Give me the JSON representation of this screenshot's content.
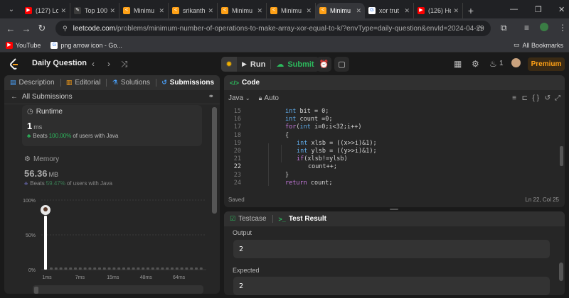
{
  "browser": {
    "tabs": [
      {
        "title": "(127) Lo",
        "fav_color": "#ff0000",
        "fav_glyph": "▶",
        "active": false
      },
      {
        "title": "Top 100",
        "fav_color": "#3b3b3b",
        "fav_glyph": "✎",
        "active": false
      },
      {
        "title": "Minimu",
        "fav_color": "#ffa116",
        "fav_glyph": "<",
        "active": false
      },
      {
        "title": "srikanth",
        "fav_color": "#ffa116",
        "fav_glyph": "<",
        "active": false
      },
      {
        "title": "Minimu",
        "fav_color": "#ffa116",
        "fav_glyph": "<",
        "active": false
      },
      {
        "title": "Minimu",
        "fav_color": "#ffa116",
        "fav_glyph": "<",
        "active": false
      },
      {
        "title": "Minimu",
        "fav_color": "#ffa116",
        "fav_glyph": "<",
        "active": true
      },
      {
        "title": "xor trut",
        "fav_color": "#ffffff",
        "fav_glyph": "G",
        "active": false
      },
      {
        "title": "(126) He",
        "fav_color": "#ff0000",
        "fav_glyph": "▶",
        "active": false
      }
    ],
    "url_host": "leetcode.com",
    "url_path": "/problems/minimum-number-of-operations-to-make-array-xor-equal-to-k/?envType=daily-question&envId=2024-04-29",
    "bookmarks": [
      {
        "label": "YouTube",
        "color": "#ff0000",
        "glyph": "▶"
      },
      {
        "label": "png arrow icon - Go...",
        "color": "#ffffff",
        "glyph": "G"
      }
    ],
    "all_bookmarks": "All Bookmarks"
  },
  "header": {
    "title": "Daily Question",
    "run_label": "Run",
    "submit_label": "Submit",
    "streak_count": "1",
    "premium_label": "Premium"
  },
  "left_panel": {
    "tabs": [
      {
        "label": "Description",
        "icon": "▤",
        "color": "#4aa3ff"
      },
      {
        "label": "Editorial",
        "icon": "▥",
        "color": "#ffa116"
      },
      {
        "label": "Solutions",
        "icon": "⚗",
        "color": "#4aa3ff"
      },
      {
        "label": "Submissions",
        "icon": "↺",
        "color": "#4aa3ff"
      }
    ],
    "sub_title": "All Submissions",
    "runtime": {
      "label": "Runtime",
      "value": "1",
      "unit": "ms",
      "beats_prefix": "Beats",
      "beats_pct": "100.00%",
      "beats_suffix": "of users with Java"
    },
    "memory": {
      "label": "Memory",
      "value": "56.36",
      "unit": "MB",
      "beats_prefix": "Beats",
      "beats_pct": "59.47%",
      "beats_suffix": "of users with Java"
    },
    "chart_data": {
      "type": "bar",
      "y_ticks": [
        "100%",
        "50%",
        "0%"
      ],
      "x_ticks": [
        "1ms",
        "7ms",
        "15ms",
        "48ms",
        "64ms"
      ],
      "highlight": {
        "x": "1ms",
        "value": 100
      }
    }
  },
  "code_panel": {
    "title": "Code",
    "language": "Java",
    "mode": "Auto",
    "lines": [
      {
        "n": "15",
        "indent": 2,
        "tokens": [
          [
            "ty",
            "int"
          ],
          [
            "tx",
            " bit = 0;"
          ]
        ]
      },
      {
        "n": "16",
        "indent": 2,
        "tokens": [
          [
            "ty",
            "int"
          ],
          [
            "tx",
            " count =0;"
          ]
        ]
      },
      {
        "n": "17",
        "indent": 2,
        "tokens": [
          [
            "kw",
            "for"
          ],
          [
            "tx",
            "("
          ],
          [
            "ty",
            "int"
          ],
          [
            "tx",
            " i=0;i<32;i++)"
          ]
        ]
      },
      {
        "n": "18",
        "indent": 2,
        "tokens": [
          [
            "tx",
            "{"
          ]
        ]
      },
      {
        "n": "19",
        "indent": 4,
        "tokens": [
          [
            "ty",
            "int"
          ],
          [
            "tx",
            " xlsb = ((x>>i)&1);"
          ]
        ]
      },
      {
        "n": "20",
        "indent": 4,
        "tokens": [
          [
            "ty",
            "int"
          ],
          [
            "tx",
            " ylsb = ((y>>i)&1);"
          ]
        ]
      },
      {
        "n": "21",
        "indent": 4,
        "tokens": [
          [
            "kw",
            "if"
          ],
          [
            "tx",
            "(xlsb!=ylsb)"
          ]
        ]
      },
      {
        "n": "22",
        "indent": 6,
        "tokens": [
          [
            "tx",
            "count++;"
          ]
        ]
      },
      {
        "n": "23",
        "indent": 2,
        "tokens": [
          [
            "tx",
            "}"
          ]
        ]
      },
      {
        "n": "24",
        "indent": 2,
        "tokens": [
          [
            "kw",
            "return"
          ],
          [
            "tx",
            " count;"
          ]
        ]
      }
    ],
    "saved": "Saved",
    "cursor": "Ln 22, Col 25"
  },
  "result_panel": {
    "tab_testcase": "Testcase",
    "tab_result": "Test Result",
    "output_label": "Output",
    "output_value": "2",
    "expected_label": "Expected",
    "expected_value": "2"
  }
}
